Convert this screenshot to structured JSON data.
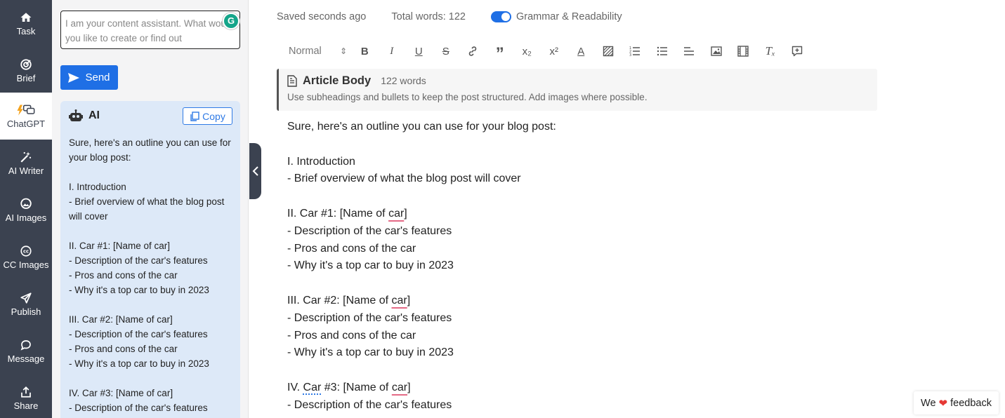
{
  "nav": {
    "items": [
      {
        "label": "Task",
        "icon": "home-icon"
      },
      {
        "label": "Brief",
        "icon": "target-icon"
      },
      {
        "label": "ChatGPT",
        "icon": "chat-bolt-icon",
        "active": true
      },
      {
        "label": "AI Writer",
        "icon": "magic-wand-icon"
      },
      {
        "label": "AI Images",
        "icon": "image-bubble-icon"
      },
      {
        "label": "CC Images",
        "icon": "cc-icon"
      },
      {
        "label": "Publish",
        "icon": "paper-plane-icon"
      },
      {
        "label": "Message",
        "icon": "message-icon"
      },
      {
        "label": "Share",
        "icon": "share-icon"
      }
    ]
  },
  "chat": {
    "input_placeholder": "I am your content assistant. What would you like to create or find out",
    "send_label": "Send",
    "ai_title": "AI",
    "copy_label": "Copy",
    "lines": [
      "Sure, here's an outline you can use for your blog post:",
      "",
      "I. Introduction",
      "- Brief overview of what the blog post will cover",
      "",
      "II. Car #1: [Name of car]",
      "- Description of the car's features",
      "- Pros and cons of the car",
      "- Why it's a top car to buy in 2023",
      "",
      "III. Car #2: [Name of car]",
      "- Description of the car's features",
      "- Pros and cons of the car",
      "- Why it's a top car to buy in 2023",
      "",
      "IV. Car #3: [Name of car]",
      "- Description of the car's features"
    ]
  },
  "status": {
    "saved": "Saved seconds ago",
    "total_words": "Total words: 122",
    "grammar_label": "Grammar & Readability",
    "grammar_on": true
  },
  "toolbar": {
    "format_value": "Normal",
    "format_arrow": "⇕",
    "bold": "B",
    "italic": "I",
    "underline": "U",
    "strike": "S",
    "quote": "”",
    "subscript": "x₂",
    "superscript": "x²",
    "color": "A",
    "clear": "Tₓ"
  },
  "article": {
    "title": "Article Body",
    "word_count": "122 words",
    "hint": "Use subheadings and bullets to keep the post structured. Add images where possible.",
    "intro": "Sure, here's an outline you can use for your blog post:",
    "l_intro": "I. Introduction",
    "l_overview": "- Brief overview of what the blog post will cover",
    "c1_pre": "II. Car #1: [Name of ",
    "car_word": "car",
    "bracket": "]",
    "features": "- Description of the car's features",
    "pros": "- Pros and cons of the car",
    "why": "- Why it's a top car to buy in 2023",
    "c2_pre": "III. Car #2: [Name of ",
    "c3_num": "IV. ",
    "c3_car": "Car",
    "c3_mid": " #3: [Name of "
  },
  "feedback": {
    "pre": "We",
    "heart": "❤",
    "post": "feedback"
  },
  "colors": {
    "nav_bg": "#3b4250",
    "accent": "#1f6fe5",
    "ai_card_bg": "#dde9f8"
  }
}
